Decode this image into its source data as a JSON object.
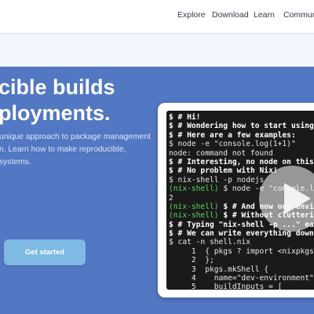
{
  "nav": {
    "links": [
      "Explore",
      "Download",
      "Learn",
      "Community"
    ]
  },
  "hero": {
    "headline": [
      "cible builds",
      "ployments."
    ],
    "subtext": [
      "unique approach to package management",
      "n. Learn how to make reproducible,",
      "systems."
    ],
    "cta_label": "Get started"
  },
  "terminal": {
    "lines": [
      [
        {
          "t": "$ # Hi!",
          "c": "bold"
        }
      ],
      [
        {
          "t": "$ # Wondering how to start using N",
          "c": "bold"
        }
      ],
      [
        {
          "t": "$ # Here are a few examples:",
          "c": "bold"
        }
      ],
      [
        {
          "t": "$ node -e \"console.log(1+1)\"",
          "c": "white"
        }
      ],
      [
        {
          "t": "node: command not found",
          "c": "white"
        }
      ],
      [
        {
          "t": "$ # Interesting, no node on this m",
          "c": "bold"
        }
      ],
      [
        {
          "t": "$ # No problem with Nix!",
          "c": "bold"
        }
      ],
      [
        {
          "t": "$ nix-shell -p nodejs",
          "c": "white"
        }
      ],
      [
        {
          "t": "(nix-shell) ",
          "c": "green"
        },
        {
          "t": "$ node -e \"console.lo",
          "c": "white"
        }
      ],
      [
        {
          "t": "2",
          "c": "white"
        }
      ],
      [
        {
          "t": "(nix-shell) ",
          "c": "green"
        },
        {
          "t": "$ # And now our enviro",
          "c": "bold"
        }
      ],
      [
        {
          "t": "(nix-shell) ",
          "c": "green"
        },
        {
          "t": "$ # Without cluttering",
          "c": "bold"
        }
      ],
      [
        {
          "t": "$ # Typing \"nix-shell -p ...\" each",
          "c": "bold"
        }
      ],
      [
        {
          "t": "$ # We can write everything down i",
          "c": "bold"
        }
      ],
      [
        {
          "t": "$ cat -n shell.nix",
          "c": "white"
        }
      ],
      [
        {
          "t": "     1  { pkgs ? import <nixpkgs> {",
          "c": "white"
        }
      ],
      [
        {
          "t": "     2  };",
          "c": "white"
        }
      ],
      [
        {
          "t": "     3  pkgs.mkShell {",
          "c": "white"
        }
      ],
      [
        {
          "t": "     4    name=\"dev-environment\";",
          "c": "white"
        }
      ],
      [
        {
          "t": "     5    buildInputs = [",
          "c": "white"
        }
      ]
    ]
  },
  "colors": {
    "hero_bg": "#5277c3",
    "cta_bg": "#7ebae4",
    "prompt_green": "#5fd35f",
    "terminal_bg": "#1a1a1a"
  },
  "icons": {
    "play": "play-icon"
  }
}
